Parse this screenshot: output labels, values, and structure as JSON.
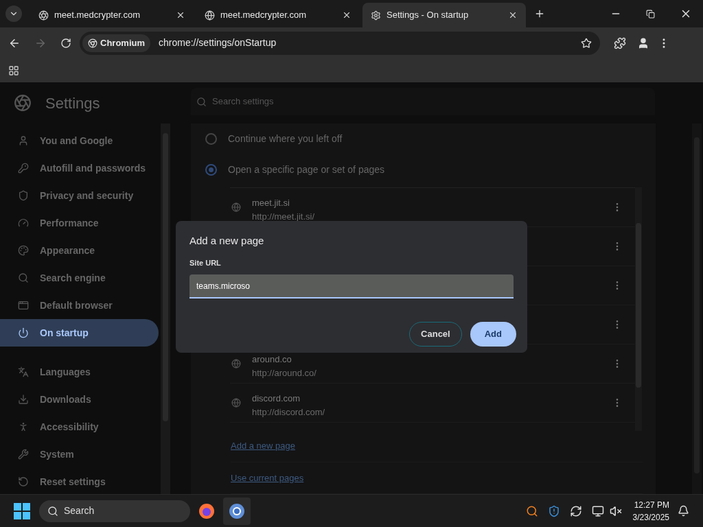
{
  "tabs": [
    {
      "title": "meet.medcrypter.com",
      "selected": false
    },
    {
      "title": "meet.medcrypter.com",
      "selected": false
    },
    {
      "title": "Settings - On startup",
      "selected": true
    }
  ],
  "address_bar": {
    "chip": "Chromium",
    "url": "chrome://settings/onStartup"
  },
  "settings": {
    "title": "Settings",
    "search": {
      "placeholder": "Search settings"
    },
    "sidebar": [
      {
        "label": "You and Google",
        "selected": false
      },
      {
        "label": "Autofill and passwords",
        "selected": false
      },
      {
        "label": "Privacy and security",
        "selected": false
      },
      {
        "label": "Performance",
        "selected": false
      },
      {
        "label": "Appearance",
        "selected": false
      },
      {
        "label": "Search engine",
        "selected": false
      },
      {
        "label": "Default browser",
        "selected": false
      },
      {
        "label": "On startup",
        "selected": true
      },
      {
        "label": "Languages",
        "selected": false
      },
      {
        "label": "Downloads",
        "selected": false
      },
      {
        "label": "Accessibility",
        "selected": false
      },
      {
        "label": "System",
        "selected": false
      },
      {
        "label": "Reset settings",
        "selected": false
      }
    ],
    "startup_options": [
      {
        "label": "Continue where you left off",
        "selected": false
      },
      {
        "label": "Open a specific page or set of pages",
        "selected": true
      }
    ],
    "pages": [
      {
        "name": "meet.jit.si",
        "url": "http://meet.jit.si/"
      },
      {
        "name": "around.co",
        "url": "http://around.co/"
      },
      {
        "name": "discord.com",
        "url": "http://discord.com/"
      }
    ],
    "links": [
      "Add a new page",
      "Use current pages"
    ]
  },
  "dialog": {
    "title": "Add a new page",
    "field_label": "Site URL",
    "value": "teams.microso",
    "buttons": [
      {
        "label": "Cancel",
        "kind": "secondary"
      },
      {
        "label": "Add",
        "kind": "primary"
      }
    ]
  },
  "taskbar": {
    "search": {
      "placeholder": "Search"
    },
    "time": "12:27 PM",
    "date": "3/23/2025"
  }
}
